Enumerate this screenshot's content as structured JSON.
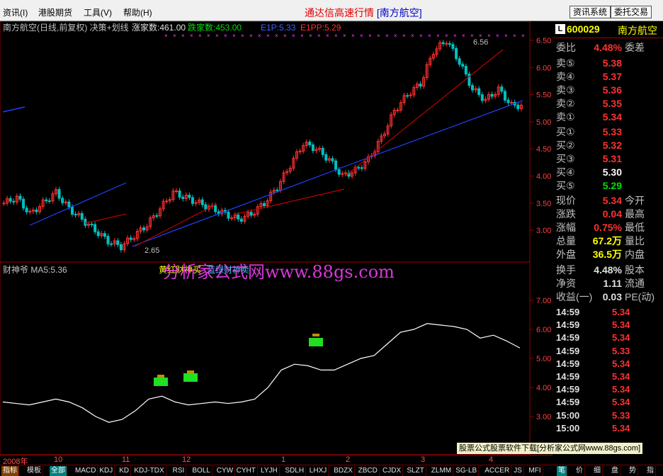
{
  "menu": [
    "资讯(I)",
    "港股期货",
    "工具(V)",
    "帮助(H)"
  ],
  "app_title": "通达信高速行情",
  "app_stock": "[南方航空]",
  "top_buttons": [
    "资讯系统",
    "委托交易"
  ],
  "main_panel": {
    "label": "南方航空(日线,前复权) 决策+划线",
    "up_count": "涨家数:461.00",
    "down_count": "跌家数:453.00",
    "e1p": "E1P:5.33",
    "e1pp": "E1PP:5.29",
    "high_mark": "6.56",
    "low_mark": "2.65",
    "y_ticks": [
      "6.50",
      "6.00",
      "5.50",
      "5.00",
      "4.50",
      "4.00",
      "3.50",
      "3.00"
    ]
  },
  "sub_panel": {
    "label": "财神爷 MA5:5.36",
    "legend_yellow": "黄红财神买",
    "legend_blue": "蓝绿财神卖",
    "watermark": "分析家公式网www.88gs.com",
    "y_ticks": [
      "7.00",
      "6.00",
      "5.00",
      "4.00",
      "3.00"
    ]
  },
  "chart_data": {
    "type": "line",
    "title": "南方航空(日线,前复权)",
    "candles_close_series": [
      3.5,
      3.6,
      3.3,
      3.5,
      3.7,
      3.4,
      3.2,
      3.0,
      2.8,
      2.7,
      2.9,
      3.1,
      3.4,
      3.7,
      3.6,
      3.5,
      3.4,
      3.3,
      3.2,
      3.3,
      3.5,
      3.8,
      4.2,
      4.6,
      4.5,
      4.3,
      4.0,
      4.1,
      4.3,
      4.7,
      5.2,
      5.5,
      5.7,
      6.3,
      6.5,
      6.1,
      5.6,
      5.4,
      5.6,
      5.3
    ],
    "sub_series": [
      {
        "name": "MA5",
        "values": [
          3.5,
          3.45,
          3.4,
          3.5,
          3.6,
          3.5,
          3.3,
          3.0,
          2.8,
          2.9,
          3.2,
          3.6,
          3.7,
          3.5,
          3.4,
          3.45,
          3.5,
          3.45,
          3.5,
          3.6,
          4.0,
          4.6,
          4.8,
          4.75,
          4.6,
          4.6,
          4.8,
          5.0,
          5.1,
          5.5,
          5.9,
          6.0,
          6.2,
          6.15,
          6.1,
          6.0,
          5.7,
          5.8,
          5.6,
          5.36
        ]
      }
    ],
    "ylim_main": [
      2.65,
      6.56
    ],
    "ylim_sub": [
      2.6,
      7.4
    ]
  },
  "x_axis": [
    "2008年",
    "10",
    "11",
    "12",
    "1",
    "2",
    "3",
    "4"
  ],
  "quote": {
    "code": "600029",
    "name": "南方航空",
    "ratio_label": "委比",
    "ratio_value": "4.48%",
    "ratio_right": "委差",
    "asks": [
      [
        "卖⑤",
        "5.38"
      ],
      [
        "卖④",
        "5.37"
      ],
      [
        "卖③",
        "5.36"
      ],
      [
        "卖②",
        "5.35"
      ],
      [
        "卖①",
        "5.34"
      ]
    ],
    "bids": [
      [
        "买①",
        "5.33"
      ],
      [
        "买②",
        "5.32"
      ],
      [
        "买③",
        "5.31"
      ],
      [
        "买④",
        "5.30"
      ],
      [
        "买⑤",
        "5.29"
      ]
    ],
    "stats": [
      [
        "现价",
        "5.34",
        "今开"
      ],
      [
        "涨跌",
        "0.04",
        "最高"
      ],
      [
        "涨幅",
        "0.75%",
        "最低"
      ],
      [
        "总量",
        "67.2万",
        "量比"
      ],
      [
        "外盘",
        "36.5万",
        "内盘"
      ]
    ],
    "stats2": [
      [
        "换手",
        "4.48%",
        "股本"
      ],
      [
        "净资",
        "1.11",
        "流通"
      ],
      [
        "收益(一)",
        "0.03",
        "PE(动)"
      ]
    ],
    "ticks": [
      [
        "14:59",
        "5.34"
      ],
      [
        "14:59",
        "5.34"
      ],
      [
        "14:59",
        "5.34"
      ],
      [
        "14:59",
        "5.33"
      ],
      [
        "14:59",
        "5.34"
      ],
      [
        "14:59",
        "5.34"
      ],
      [
        "14:59",
        "5.34"
      ],
      [
        "14:59",
        "5.34"
      ],
      [
        "15:00",
        "5.33"
      ],
      [
        "15:00",
        "5.34"
      ]
    ]
  },
  "ad_text": "股票公式股票软件下载[分析家公式网www.88gs.com]",
  "tabs": [
    "指标",
    "模板",
    "全部",
    "MACD",
    "KDJ",
    "KD",
    "KDJ-TDX",
    "RSI",
    "BOLL",
    "CYW",
    "CYHT",
    "LYJH",
    "SDLH",
    "LHXJ",
    "BDZX",
    "ZBCD",
    "CJDX",
    "SLZT",
    "ZLMM",
    "SG-LB",
    "ACCER",
    "JS",
    "MFI"
  ],
  "side_tabs": [
    "笔",
    "价",
    "细",
    "盘",
    "势",
    "指"
  ]
}
